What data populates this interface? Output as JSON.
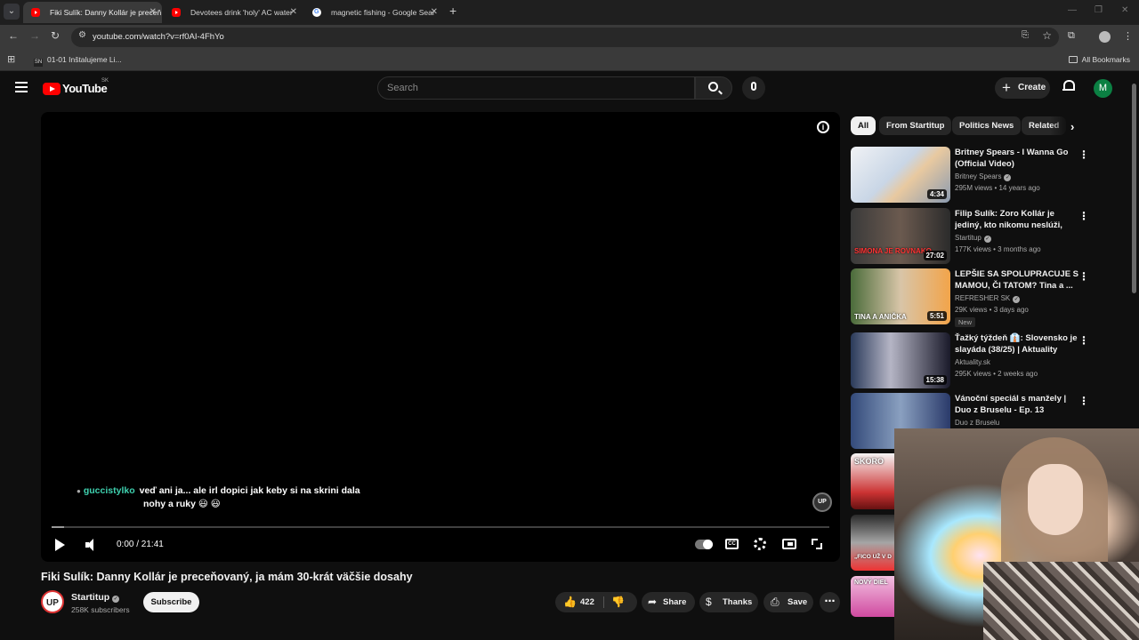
{
  "browser": {
    "tabs": [
      {
        "title": "Fiki Sulík: Danny Kollár je preceň",
        "active": true,
        "favicon": "youtube-favicon"
      },
      {
        "title": "Devotees drink 'holy' AC water",
        "active": false,
        "favicon": "youtube-favicon"
      },
      {
        "title": "magnetic fishing - Google Sear",
        "active": false,
        "favicon": "google-favicon"
      }
    ],
    "url": "youtube.com/watch?v=rf0AI-4FhYo",
    "bookmark": {
      "icon_text": "SN",
      "label": "01-01 Inštalujeme Li..."
    },
    "all_bookmarks": "All Bookmarks"
  },
  "header": {
    "logo_text": "YouTube",
    "country": "SK",
    "search_placeholder": "Search",
    "create_label": "Create",
    "avatar_letter": "M"
  },
  "player": {
    "chat_user": "guccistylko",
    "chat_message_line1": "veď ani ja... ale irl dopici jak keby si na skrini dala",
    "chat_message_line2": "nohy a ruky 😃 😃",
    "watermark": "UP",
    "time": "0:00 / 21:41",
    "progress_fraction": 0.0
  },
  "video": {
    "title": "Fiki Sulík: Danny Kollár je preceňovaný, ja mám 30-krát väčšie dosahy",
    "channel_avatar": "UP",
    "channel": "Startitup",
    "subscribers": "258K subscribers",
    "subscribe_label": "Subscribe",
    "likes": "422",
    "share_label": "Share",
    "thanks_label": "Thanks",
    "save_label": "Save"
  },
  "chips": [
    "All",
    "From Startitup",
    "Politics News",
    "Related"
  ],
  "recommendations": [
    {
      "title": "Britney Spears - I Wanna Go (Official Video)",
      "channel": "Britney Spears",
      "verified": true,
      "meta": "295M views • 14 years ago",
      "duration": "4:34"
    },
    {
      "title": "Filip Sulík: Zoro Kollár je jediný, kto nikomu neslúži, peniaze h...",
      "channel": "Startitup",
      "verified": true,
      "meta": "177K views • 3 months ago",
      "duration": "27:02",
      "thumb_text": "SIMONA JE ROVNAKO"
    },
    {
      "title": "LEPŠIE SA SPOLUPRACUJE S MAMOU, ČI TATOM? Tina a ...",
      "channel": "REFRESHER SK",
      "verified": true,
      "meta": "29K views • 3 days ago",
      "badge": "New",
      "duration": "5:51",
      "thumb_text": "TINA A ANIČKA"
    },
    {
      "title": "Ťažký týždeň 👔: Slovensko je slayáda (38/25) | Aktuality",
      "channel": "Aktuality.sk",
      "verified": false,
      "meta": "295K views • 2 weeks ago",
      "duration": "15:38"
    },
    {
      "title": "Vánoční speciál s manžely | Duo z Bruselu - Ep. 13",
      "channel": "Duo z Bruselu",
      "verified": false,
      "meta": ""
    }
  ],
  "extra_thumbs": [
    "SKORO",
    "„FICO UŽ V D",
    "NOVÝ DIEL"
  ]
}
